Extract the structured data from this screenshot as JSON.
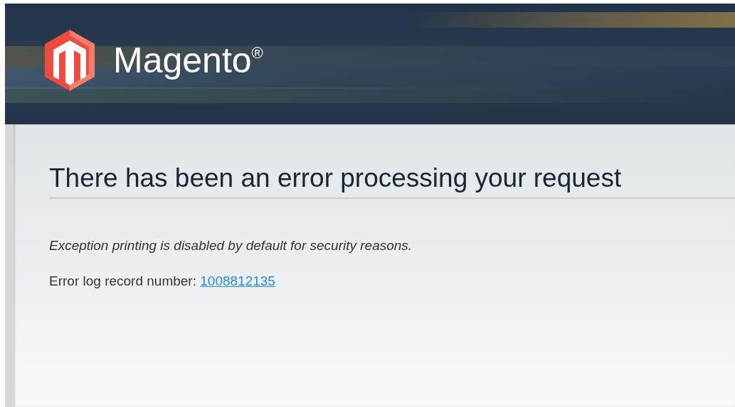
{
  "header": {
    "logo_text": "Magento$^{®}$"
  },
  "error": {
    "title": "There has been an error processing your request",
    "message": "Exception printing is disabled by default for security reasons.",
    "record_label": "Error log record number:",
    "record_number": "1008812135"
  }
}
